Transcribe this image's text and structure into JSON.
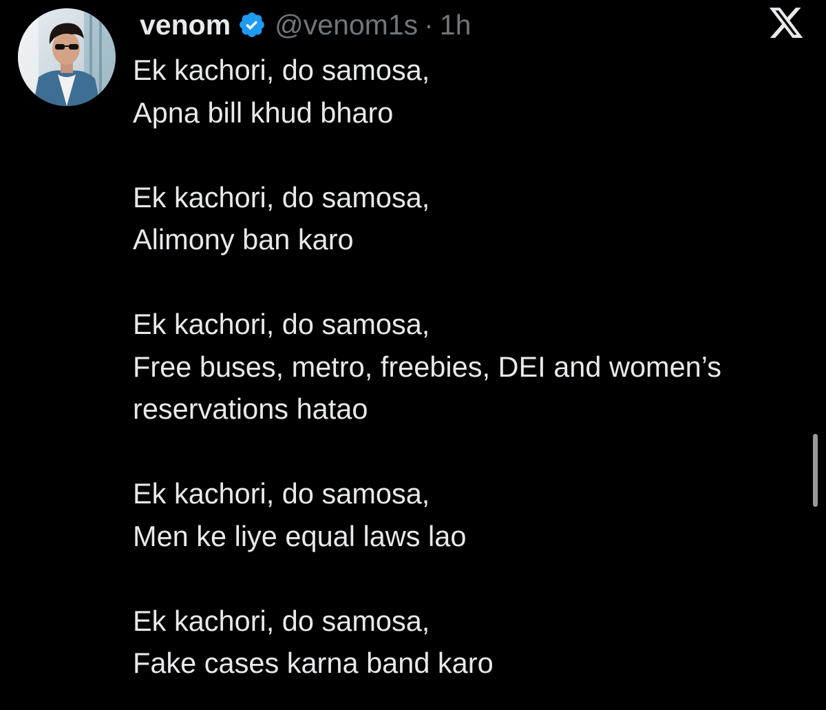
{
  "tweet": {
    "author": {
      "display_name": "venom",
      "handle": "@venom1s",
      "verified": true,
      "avatar_icon": "avatar-photo"
    },
    "separator": "·",
    "timestamp": "1h",
    "brand_icon": "x-logo-icon",
    "stanzas": [
      [
        "Ek kachori, do samosa,",
        "Apna bill khud bharo"
      ],
      [
        "Ek kachori, do samosa,",
        "Alimony ban karo"
      ],
      [
        "Ek kachori, do samosa,",
        "Free buses, metro, freebies, DEI and women’s",
        "reservations hatao"
      ],
      [
        "Ek kachori, do samosa,",
        "Men ke liye equal laws lao"
      ],
      [
        "Ek kachori, do samosa,",
        "Fake cases karna band karo"
      ]
    ]
  },
  "colors": {
    "background": "#000000",
    "text_primary": "#e7e9ea",
    "text_secondary": "#71767b",
    "verified_badge": "#1d9bf0"
  }
}
